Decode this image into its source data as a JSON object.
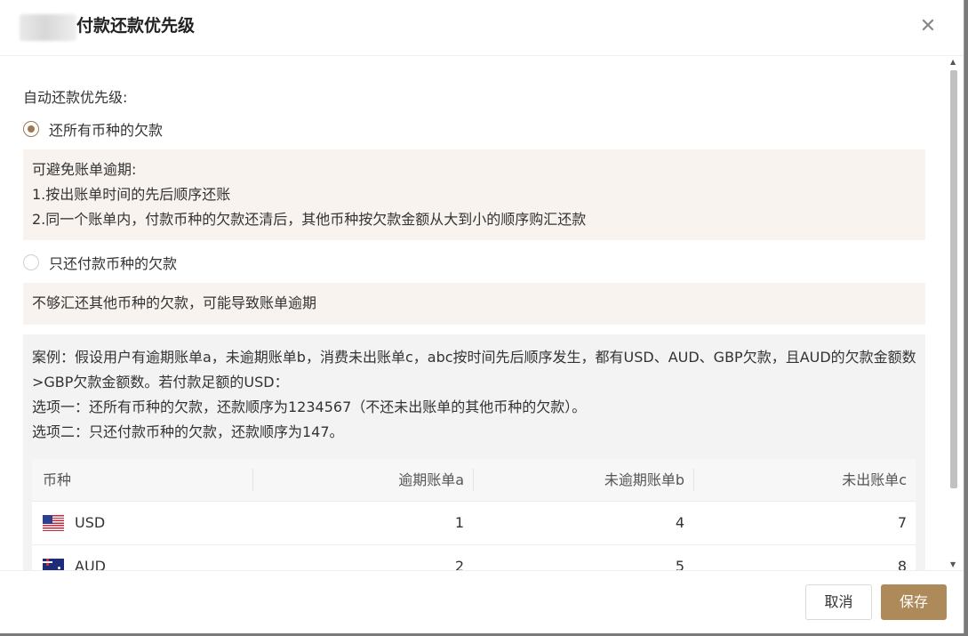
{
  "dialog": {
    "title": "付款还款优先级",
    "close_icon": "close-icon"
  },
  "section_label": "自动还款优先级:",
  "options": [
    {
      "label": "还所有币种的欠款",
      "checked": true
    },
    {
      "label": "只还付款币种的欠款",
      "checked": false
    }
  ],
  "option1_note": {
    "lines": [
      "可避免账单逾期:",
      "1.按出账单时间的先后顺序还账",
      "2.同一个账单内，付款币种的欠款还清后，其他币种按欠款金额从大到小的顺序购汇还款"
    ]
  },
  "option2_note": "不够汇还其他币种的欠款，可能导致账单逾期",
  "example": {
    "lines": [
      "案例：假设用户有逾期账单a，未逾期账单b，消费未出账单c，abc按时间先后顺序发生，都有USD、AUD、GBP欠款，且AUD的欠款金额数>GBP欠款金额数。若付款足额的USD：",
      "选项一：还所有币种的欠款，还款顺序为1234567（不还未出账单的其他币种的欠款）。",
      "选项二：只还付款币种的欠款，还款顺序为147。"
    ]
  },
  "table": {
    "headers": [
      "币种",
      "逾期账单a",
      "未逾期账单b",
      "未出账单c"
    ],
    "rows": [
      {
        "currency": "USD",
        "flag_icon": "us-flag-icon",
        "a": "1",
        "b": "4",
        "c": "7"
      },
      {
        "currency": "AUD",
        "flag_icon": "au-flag-icon",
        "a": "2",
        "b": "5",
        "c": "8"
      }
    ]
  },
  "footer": {
    "cancel_label": "取消",
    "save_label": "保存"
  },
  "colors": {
    "accent": "#ae8a5b",
    "note_bg": "#f8f3ee",
    "example_bg": "#f3f3f3"
  }
}
